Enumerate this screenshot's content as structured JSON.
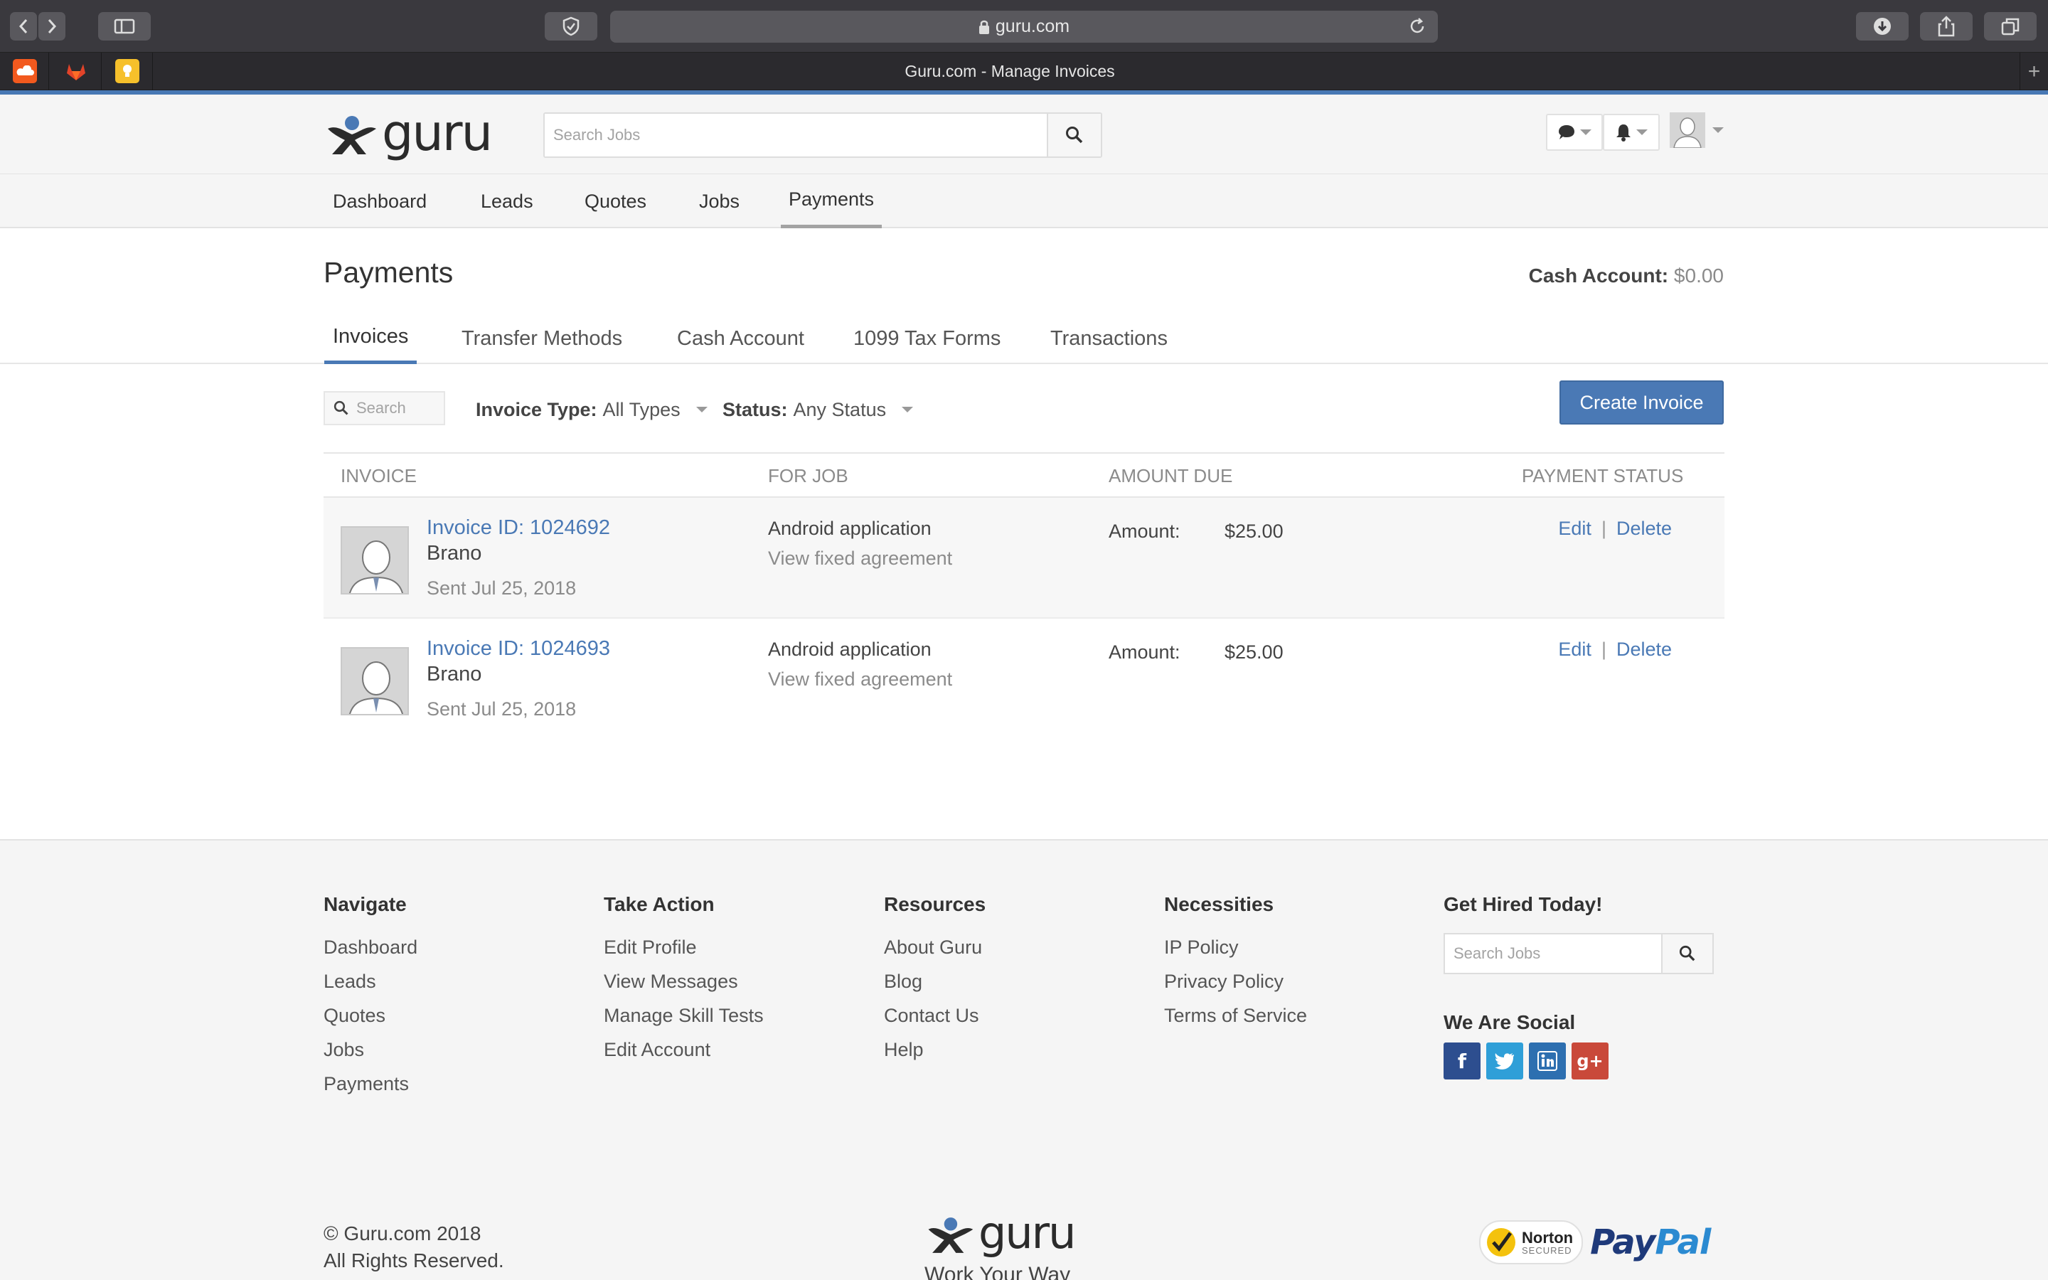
{
  "browser": {
    "url": "guru.com",
    "tab_title": "Guru.com - Manage Invoices",
    "new_tab": "+"
  },
  "header": {
    "logo_text": "guru",
    "search_placeholder": "Search Jobs"
  },
  "nav": {
    "items": [
      "Dashboard",
      "Leads",
      "Quotes",
      "Jobs",
      "Payments"
    ],
    "active": "Payments"
  },
  "page": {
    "title": "Payments",
    "cash_account_label": "Cash Account:",
    "cash_account_value": "$0.00",
    "tabs": [
      "Invoices",
      "Transfer Methods",
      "Cash Account",
      "1099 Tax Forms",
      "Transactions"
    ],
    "active_tab": "Invoices"
  },
  "filters": {
    "search_placeholder": "Search",
    "invoice_type_label": "Invoice Type:",
    "invoice_type_value": "All Types",
    "status_label": "Status:",
    "status_value": "Any Status",
    "create_button": "Create Invoice"
  },
  "table": {
    "columns": [
      "INVOICE",
      "FOR JOB",
      "AMOUNT DUE",
      "PAYMENT STATUS"
    ],
    "rows": [
      {
        "invoice_id": "Invoice ID: 1024692",
        "name": "Brano",
        "sent": "Sent Jul 25, 2018",
        "job": "Android application",
        "job_link": "View fixed agreement",
        "amount_label": "Amount:",
        "amount": "$25.00",
        "edit": "Edit",
        "separator": "|",
        "delete": "Delete"
      },
      {
        "invoice_id": "Invoice ID: 1024693",
        "name": "Brano",
        "sent": "Sent Jul 25, 2018",
        "job": "Android application",
        "job_link": "View fixed agreement",
        "amount_label": "Amount:",
        "amount": "$25.00",
        "edit": "Edit",
        "separator": "|",
        "delete": "Delete"
      }
    ]
  },
  "footer": {
    "navigate": {
      "title": "Navigate",
      "links": [
        "Dashboard",
        "Leads",
        "Quotes",
        "Jobs",
        "Payments"
      ]
    },
    "take_action": {
      "title": "Take Action",
      "links": [
        "Edit Profile",
        "View Messages",
        "Manage Skill Tests",
        "Edit Account"
      ]
    },
    "resources": {
      "title": "Resources",
      "links": [
        "About Guru",
        "Blog",
        "Contact Us",
        "Help"
      ]
    },
    "necessities": {
      "title": "Necessities",
      "links": [
        "IP Policy",
        "Privacy Policy",
        "Terms of Service"
      ]
    },
    "hired": {
      "title": "Get Hired Today!",
      "search_placeholder": "Search Jobs"
    },
    "social": {
      "title": "We Are Social",
      "facebook": "f",
      "google": "g+"
    },
    "copyright_line1": "© Guru.com 2018",
    "copyright_line2": "All Rights Reserved.",
    "logo_text": "guru",
    "tagline": "Work Your Way",
    "norton_1": "Norton",
    "norton_2": "SECURED",
    "paypal_1": "Pay",
    "paypal_2": "Pal"
  },
  "colors": {
    "accent": "#4a79b5",
    "chrome_dark": "#3a393e",
    "footer_bg": "#f5f5f5"
  }
}
